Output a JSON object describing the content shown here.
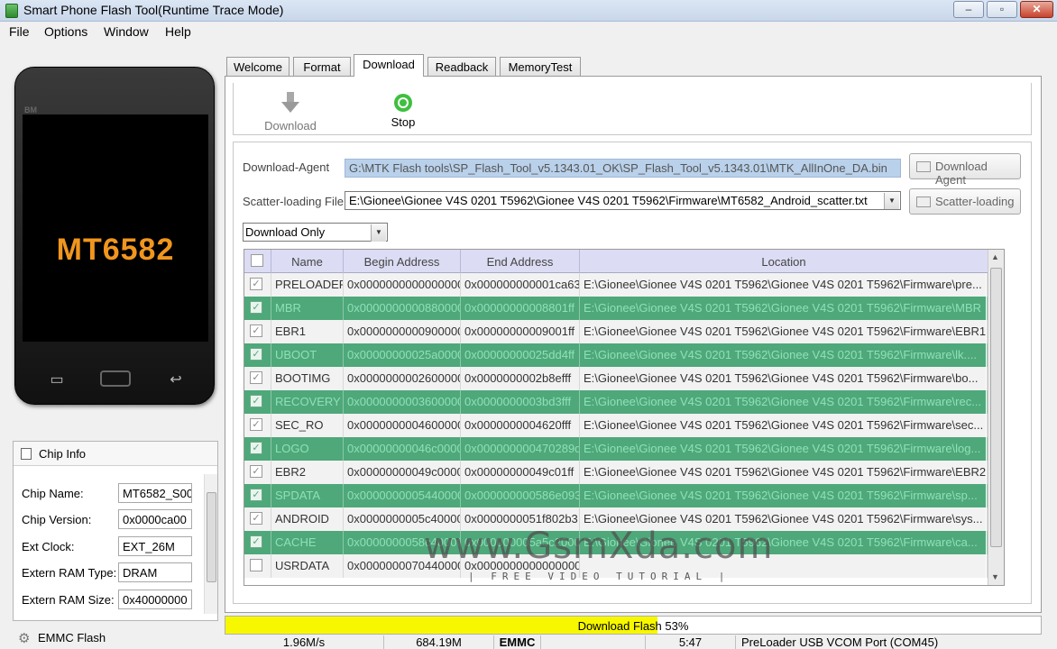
{
  "window": {
    "title": "Smart Phone Flash Tool(Runtime Trace Mode)",
    "minimize": "–",
    "restore": "▫",
    "close": "✕"
  },
  "menu": [
    "File",
    "Options",
    "Window",
    "Help"
  ],
  "phone": {
    "brand": "BM",
    "model": "MT6582"
  },
  "chip_info": {
    "header": "Chip Info",
    "rows": [
      {
        "label": "Chip Name:",
        "value": "MT6582_S00"
      },
      {
        "label": "Chip Version:",
        "value": "0x0000ca00"
      },
      {
        "label": "Ext Clock:",
        "value": "EXT_26M"
      },
      {
        "label": "Extern RAM Type:",
        "value": "DRAM"
      },
      {
        "label": "Extern RAM Size:",
        "value": "0x40000000"
      }
    ]
  },
  "emmc_flash": {
    "label": "EMMC Flash"
  },
  "tabs": [
    "Welcome",
    "Format",
    "Download",
    "Readback",
    "MemoryTest"
  ],
  "active_tab": "Download",
  "toolbar": {
    "download_label": "Download",
    "stop_label": "Stop"
  },
  "download_agent": {
    "label": "Download-Agent",
    "path": "G:\\MTK Flash tools\\SP_Flash_Tool_v5.1343.01_OK\\SP_Flash_Tool_v5.1343.01\\MTK_AllInOne_DA.bin",
    "button": "Download Agent"
  },
  "scatter": {
    "label": "Scatter-loading File",
    "path": "E:\\Gionee\\Gionee V4S 0201 T5962\\Gionee V4S 0201 T5962\\Firmware\\MT6582_Android_scatter.txt",
    "button": "Scatter-loading"
  },
  "mode": {
    "selected": "Download Only"
  },
  "table": {
    "columns": [
      "Name",
      "Begin Address",
      "End Address",
      "Location"
    ],
    "rows": [
      {
        "checked": true,
        "name": "PRELOADER",
        "begin": "0x0000000000000000",
        "end": "0x000000000001ca63",
        "location": "E:\\Gionee\\Gionee V4S 0201 T5962\\Gionee V4S 0201 T5962\\Firmware\\pre..."
      },
      {
        "checked": true,
        "name": "MBR",
        "begin": "0x0000000000880000",
        "end": "0x00000000008801ff",
        "location": "E:\\Gionee\\Gionee V4S 0201 T5962\\Gionee V4S 0201 T5962\\Firmware\\MBR"
      },
      {
        "checked": true,
        "name": "EBR1",
        "begin": "0x0000000000900000",
        "end": "0x00000000009001ff",
        "location": "E:\\Gionee\\Gionee V4S 0201 T5962\\Gionee V4S 0201 T5962\\Firmware\\EBR1"
      },
      {
        "checked": true,
        "name": "UBOOT",
        "begin": "0x00000000025a0000",
        "end": "0x00000000025dd4ff",
        "location": "E:\\Gionee\\Gionee V4S 0201 T5962\\Gionee V4S 0201 T5962\\Firmware\\lk...."
      },
      {
        "checked": true,
        "name": "BOOTIMG",
        "begin": "0x0000000002600000",
        "end": "0x0000000002b8efff",
        "location": "E:\\Gionee\\Gionee V4S 0201 T5962\\Gionee V4S 0201 T5962\\Firmware\\bo..."
      },
      {
        "checked": true,
        "name": "RECOVERY",
        "begin": "0x0000000003600000",
        "end": "0x0000000003bd3fff",
        "location": "E:\\Gionee\\Gionee V4S 0201 T5962\\Gionee V4S 0201 T5962\\Firmware\\rec..."
      },
      {
        "checked": true,
        "name": "SEC_RO",
        "begin": "0x0000000004600000",
        "end": "0x0000000004620fff",
        "location": "E:\\Gionee\\Gionee V4S 0201 T5962\\Gionee V4S 0201 T5962\\Firmware\\sec..."
      },
      {
        "checked": true,
        "name": "LOGO",
        "begin": "0x00000000046c0000",
        "end": "0x000000000470289d",
        "location": "E:\\Gionee\\Gionee V4S 0201 T5962\\Gionee V4S 0201 T5962\\Firmware\\log..."
      },
      {
        "checked": true,
        "name": "EBR2",
        "begin": "0x00000000049c0000",
        "end": "0x00000000049c01ff",
        "location": "E:\\Gionee\\Gionee V4S 0201 T5962\\Gionee V4S 0201 T5962\\Firmware\\EBR2"
      },
      {
        "checked": true,
        "name": "SPDATA",
        "begin": "0x0000000005440000",
        "end": "0x000000000586e093",
        "location": "E:\\Gionee\\Gionee V4S 0201 T5962\\Gionee V4S 0201 T5962\\Firmware\\sp..."
      },
      {
        "checked": true,
        "name": "ANDROID",
        "begin": "0x0000000005c40000",
        "end": "0x0000000051f802b3",
        "location": "E:\\Gionee\\Gionee V4S 0201 T5962\\Gionee V4S 0201 T5962\\Firmware\\sys..."
      },
      {
        "checked": true,
        "name": "CACHE",
        "begin": "0x0000000058c40000",
        "end": "0x000000005a5c2000",
        "location": "E:\\Gionee\\Gionee V4S 0201 T5962\\Gionee V4S 0201 T5962\\Firmware\\ca..."
      },
      {
        "checked": false,
        "name": "USRDATA",
        "begin": "0x0000000070440000",
        "end": "0x0000000000000000",
        "location": ""
      }
    ]
  },
  "watermark": {
    "main": "www.GsmXda.com",
    "sub": "| FREE VIDEO TUTORIAL |"
  },
  "progress": {
    "label": "Download Flash 53%",
    "percent": 53,
    "fill_color": "#f7f700"
  },
  "status_bar": {
    "speed": "1.96M/s",
    "size": "684.19M",
    "storage": "EMMC",
    "time": "5:47",
    "port": "PreLoader USB VCOM Port (COM45)"
  }
}
